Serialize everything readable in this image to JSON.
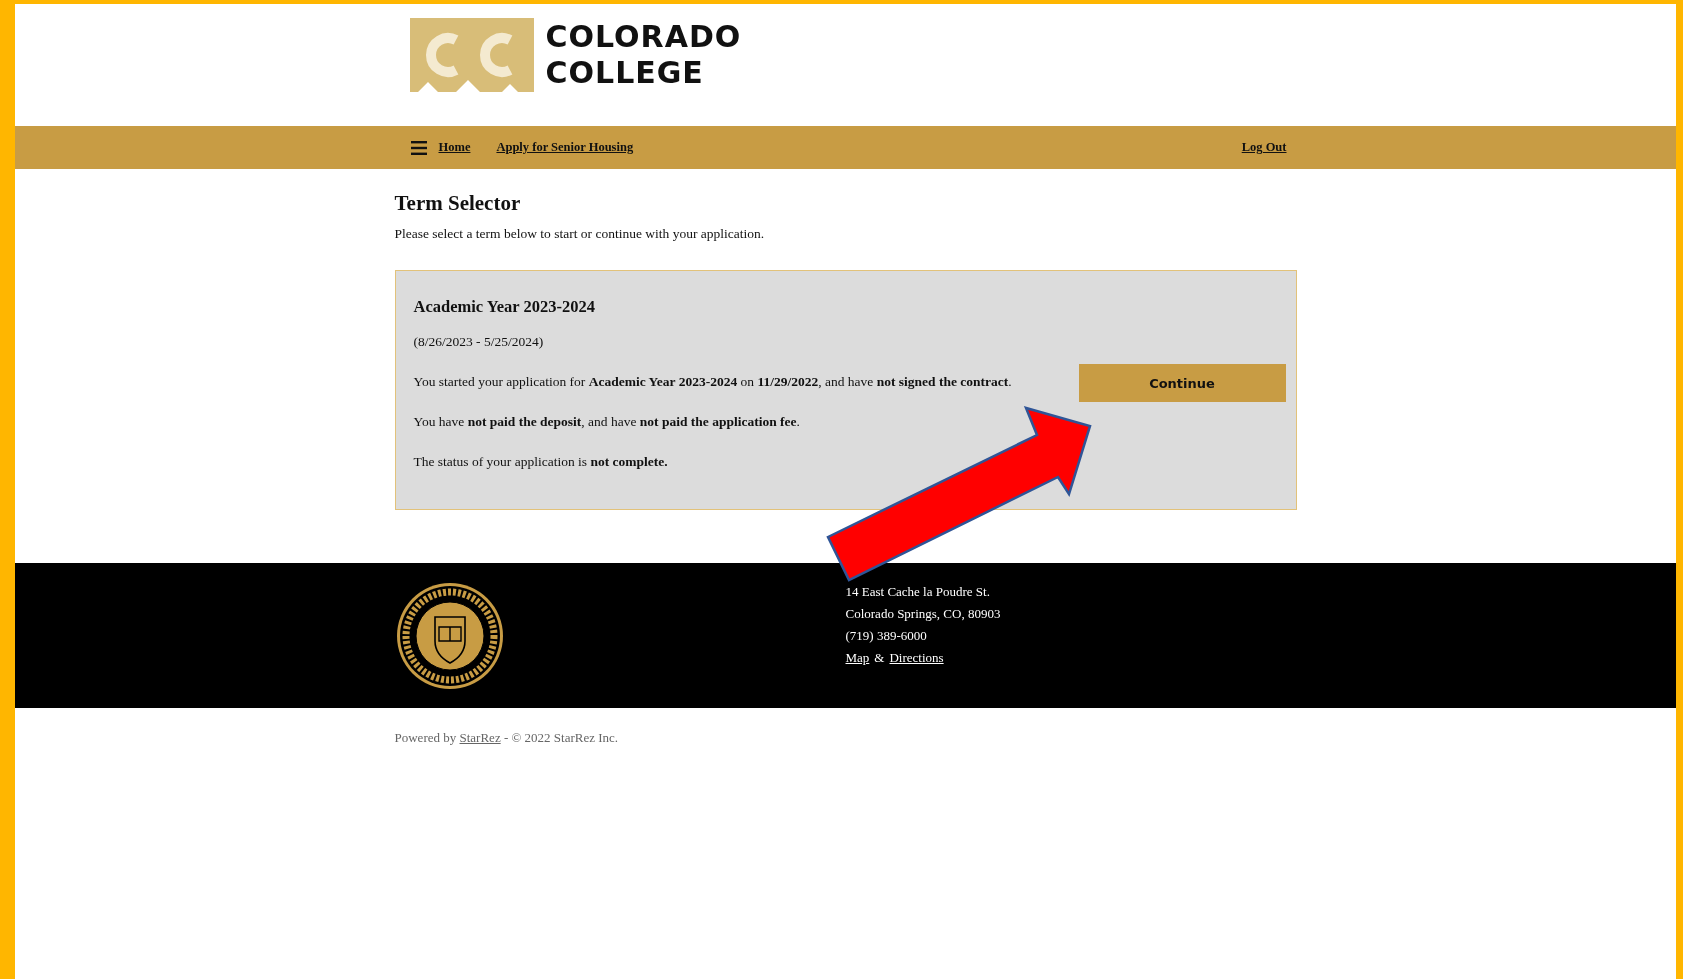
{
  "header": {
    "logo": {
      "lines": [
        "COLORADO",
        "COLLEGE"
      ]
    }
  },
  "nav": {
    "links": [
      {
        "label": "Home"
      },
      {
        "label": "Apply for Senior Housing"
      }
    ],
    "logout": "Log Out"
  },
  "page": {
    "title": "Term Selector",
    "intro": "Please select a term below to start or continue with your application."
  },
  "terms": [
    {
      "name": "Academic Year 2023-2024",
      "dates": "(8/26/2023 - 5/25/2024)",
      "paragraphs": [
        "You started your application for **Academic Year 2023-2024** on **11/29/2022**, and have **not signed the contract**.",
        "You have **not paid the deposit**, and have **not paid the application fee**.",
        "The status of your application is **not complete.**"
      ],
      "button": "Continue"
    }
  ],
  "footer": {
    "address": [
      "14 East Cache la Poudre St.",
      "Colorado Springs, CO, 80903",
      "(719) 389-6000"
    ],
    "links": [
      "Map",
      "Directions"
    ],
    "joiner": "&"
  },
  "powered": {
    "prefix": "Powered by",
    "link": "StarRez",
    "suffix": "- © 2022 StarRez Inc."
  }
}
